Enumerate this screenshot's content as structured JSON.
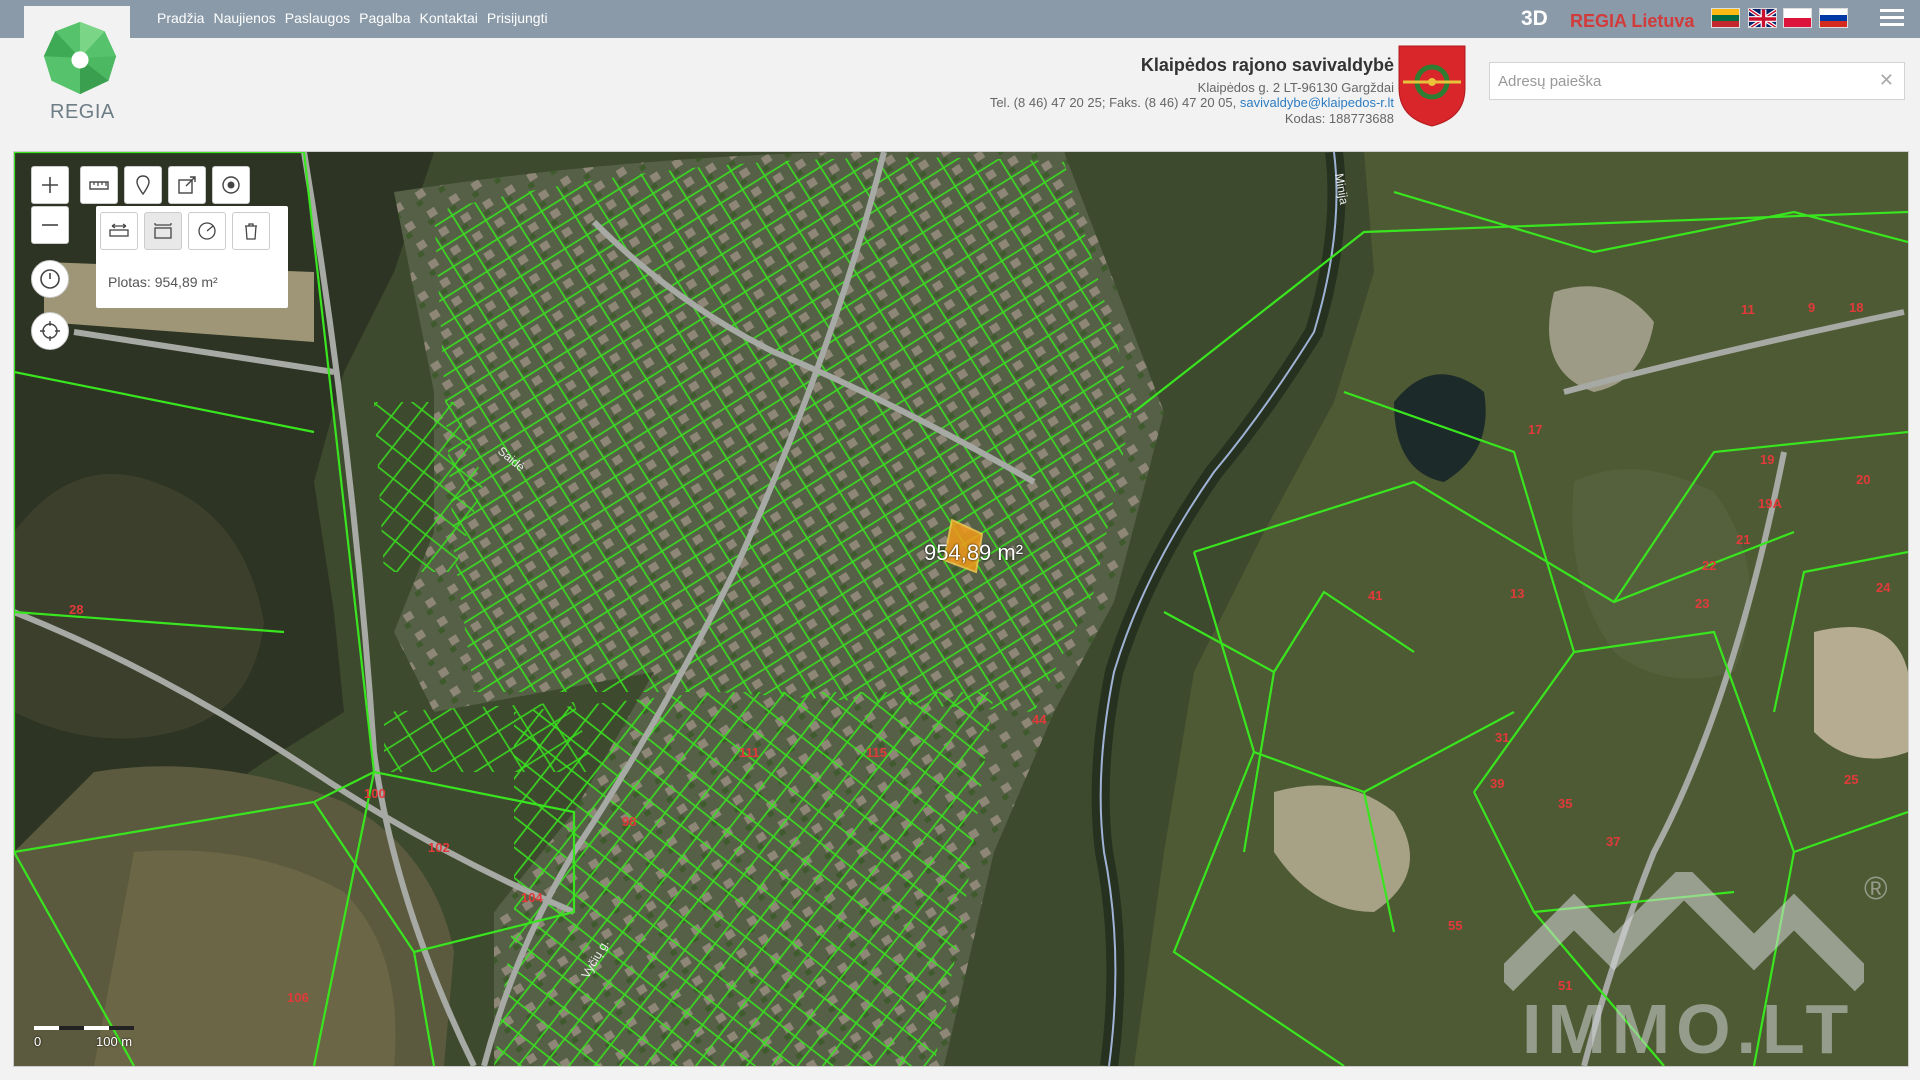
{
  "nav": {
    "items": [
      "Pradžia",
      "Naujienos",
      "Paslaugos",
      "Pagalba",
      "Kontaktai",
      "Prisijungti"
    ]
  },
  "topright": {
    "mode_3d": "3D",
    "brand": "REGIA Lietuva",
    "languages": [
      "lt-flag",
      "en-flag",
      "pl-flag",
      "ru-flag"
    ]
  },
  "logo": {
    "text": "REGIA"
  },
  "municipality": {
    "name": "Klaipėdos rajono savivaldybė",
    "address": "Klaipėdos g. 2 LT-96130 Gargždai",
    "phone_prefix": "Tel. (8 46) 47 20 25; Faks. (8 46) 47 20 05,",
    "email": "savivaldybe@klaipedos-r.lt",
    "code": "Kodas: 188773688"
  },
  "search": {
    "placeholder": "Adresų paieška",
    "value": ""
  },
  "map": {
    "area_label": "Plotas: 954,89 m²",
    "measure_label": "954,89 m²",
    "scale_start": "0",
    "scale_end": "100 m",
    "watermark": "IMMO.LT",
    "watermark_reg": "®",
    "road_label_1": "Saidė",
    "road_label_2": "Vyčių g.",
    "river_label": "Minija",
    "plot_labels": [
      "28",
      "100",
      "102",
      "104",
      "106",
      "98",
      "111",
      "115",
      "44",
      "41",
      "31",
      "39",
      "35",
      "37",
      "55",
      "51",
      "17",
      "19",
      "19A",
      "20",
      "21",
      "23",
      "22",
      "24",
      "25",
      "13",
      "11",
      "9",
      "18"
    ]
  },
  "colors": {
    "topbar": "#8a9aa8",
    "parcel_line": "#39e51f",
    "plot_label": "#e23a3a",
    "brand_red": "#d23b3b",
    "link": "#2d7cc1",
    "selection": "#f39a1a"
  }
}
